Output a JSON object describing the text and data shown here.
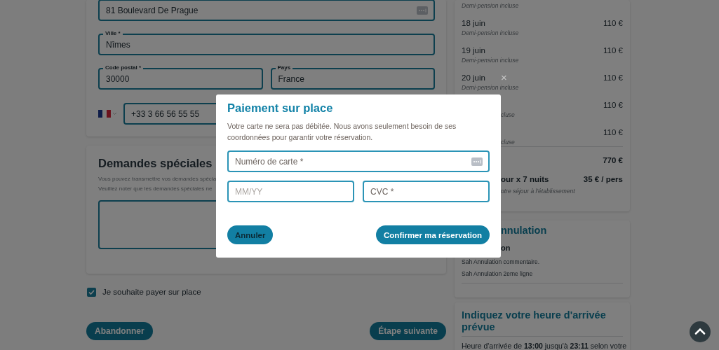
{
  "address_form": {
    "fields": [
      {
        "kind": "autofill",
        "value": "81 Boulevard De Prague"
      },
      {
        "kind": "text",
        "label": "Ville *",
        "value": "Nîmes"
      },
      {
        "kind": "text",
        "label": "Code postal *",
        "value": "30000"
      },
      {
        "kind": "text",
        "label": "Pays",
        "value": "France"
      }
    ],
    "phone": {
      "value": "+33 3 66 56 55 55"
    }
  },
  "special_requests": {
    "title": "Demandes spéciales",
    "notes": [
      "Vous pouvez transmettre vos demandes spécia",
      "Veuillez noter que les demandes spéciales ne"
    ]
  },
  "pay_on_site": {
    "label": "Je souhaite payer sur place",
    "checked": true
  },
  "actions": [
    "Abandonner",
    "Étape suivante"
  ],
  "price_list": {
    "rows": [
      {
        "note": "Demi-pension incluse"
      },
      {
        "date": "18 juin",
        "price": "110 €",
        "note": "Demi-pension incluse"
      },
      {
        "date": "19 juin",
        "price": "110 €",
        "note": "Demi-pension incluse"
      },
      {
        "date": "20 juin",
        "price": "110 €",
        "note": "Demi-pension incluse"
      },
      {
        "price": "110 €",
        "note": "cluse"
      },
      {
        "price": "110 €",
        "note": "cluse"
      }
    ],
    "total": "770 €",
    "tax": {
      "label": "our x 7 nuits",
      "amount": "35 € / pers",
      "note": "otre séjour à l'établissement"
    }
  },
  "cancellation": {
    "title": "nnulation",
    "subtitle": "on",
    "lines": [
      "Sah Annulation commentaire.",
      "Sah Annulation 2eme ligne"
    ]
  },
  "arrival": {
    "title": "Indiquez votre heure d'arrivée prévue",
    "text": "Heure d'arrivée de **13:00** jusqu'à **23:11** selon votre"
  },
  "modal": {
    "title": "Paiement sur place",
    "text": "Votre carte ne sera pas débitée. Nous avons seulement besoin de ses coordonnées pour garantir votre réservation.",
    "close": "×",
    "fields": [
      {
        "kind": "card",
        "placeholder": "Numéro de carte *"
      },
      {
        "kind": "expiry",
        "placeholder": "MM/YY"
      },
      {
        "kind": "cvc",
        "placeholder": "CVC *"
      }
    ],
    "buttons": [
      {
        "kind": "secondary",
        "label": "Annuler"
      },
      {
        "kind": "primary",
        "label": "Confirmer ma réservation"
      }
    ]
  }
}
